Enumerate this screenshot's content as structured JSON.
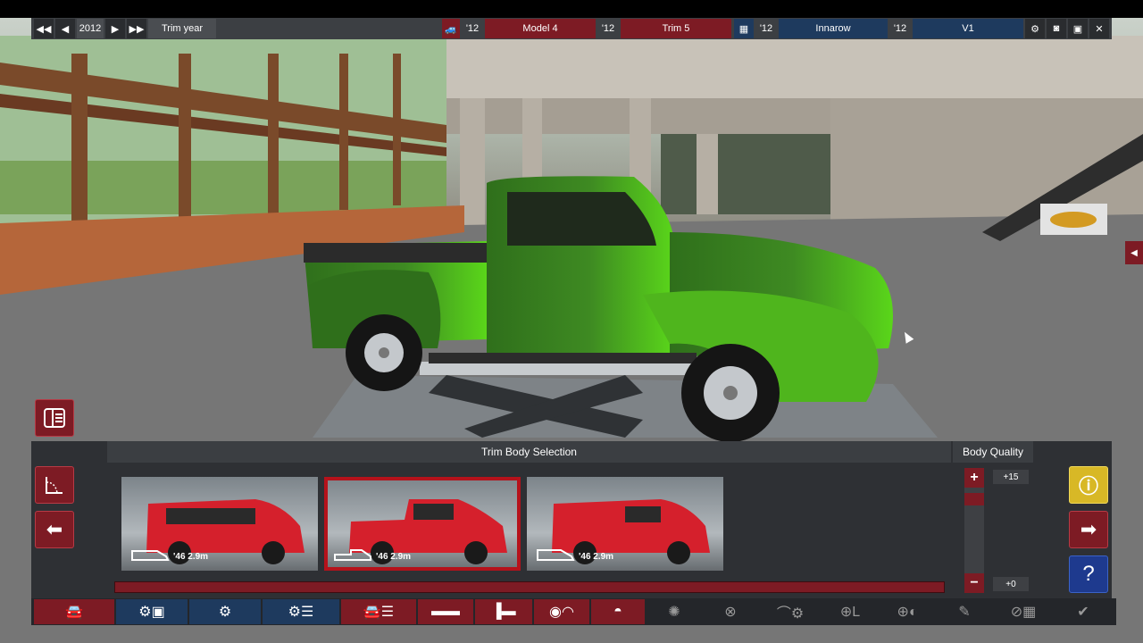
{
  "toolbar": {
    "year": "2012",
    "trim_year_label": "Trim year",
    "model_year": "'12",
    "model_name": "Model 4",
    "trim_year2": "'12",
    "trim_name": "Trim 5",
    "engine_year": "'12",
    "engine_name": "Innarow",
    "variant_year": "'12",
    "variant_name": "V1"
  },
  "panel": {
    "title": "Trim Body Selection",
    "body_quality_title": "Body Quality",
    "quality_max": "+15",
    "quality_min": "+0",
    "bodies": [
      {
        "label": "'46 2.9m",
        "type": "suv",
        "selected": false
      },
      {
        "label": "'46 2.9m",
        "type": "pickup",
        "selected": true
      },
      {
        "label": "'46 2.9m",
        "type": "van",
        "selected": false
      }
    ]
  },
  "colors": {
    "accent_red": "#7d1b24",
    "accent_blue": "#1e3a5e",
    "warning_yellow": "#d8b826",
    "truck_green": "#3e8a22"
  },
  "nav_icons": [
    "car-icon",
    "chassis-icon",
    "engine-icon",
    "engine-tune-icon",
    "body-trim-icon",
    "interior-icon",
    "fixtures-icon",
    "aero-icon",
    "wheels-icon",
    "test-icon",
    "drive-icon",
    "steering-icon",
    "quality-icon",
    "cost-icon",
    "finish-icon"
  ]
}
